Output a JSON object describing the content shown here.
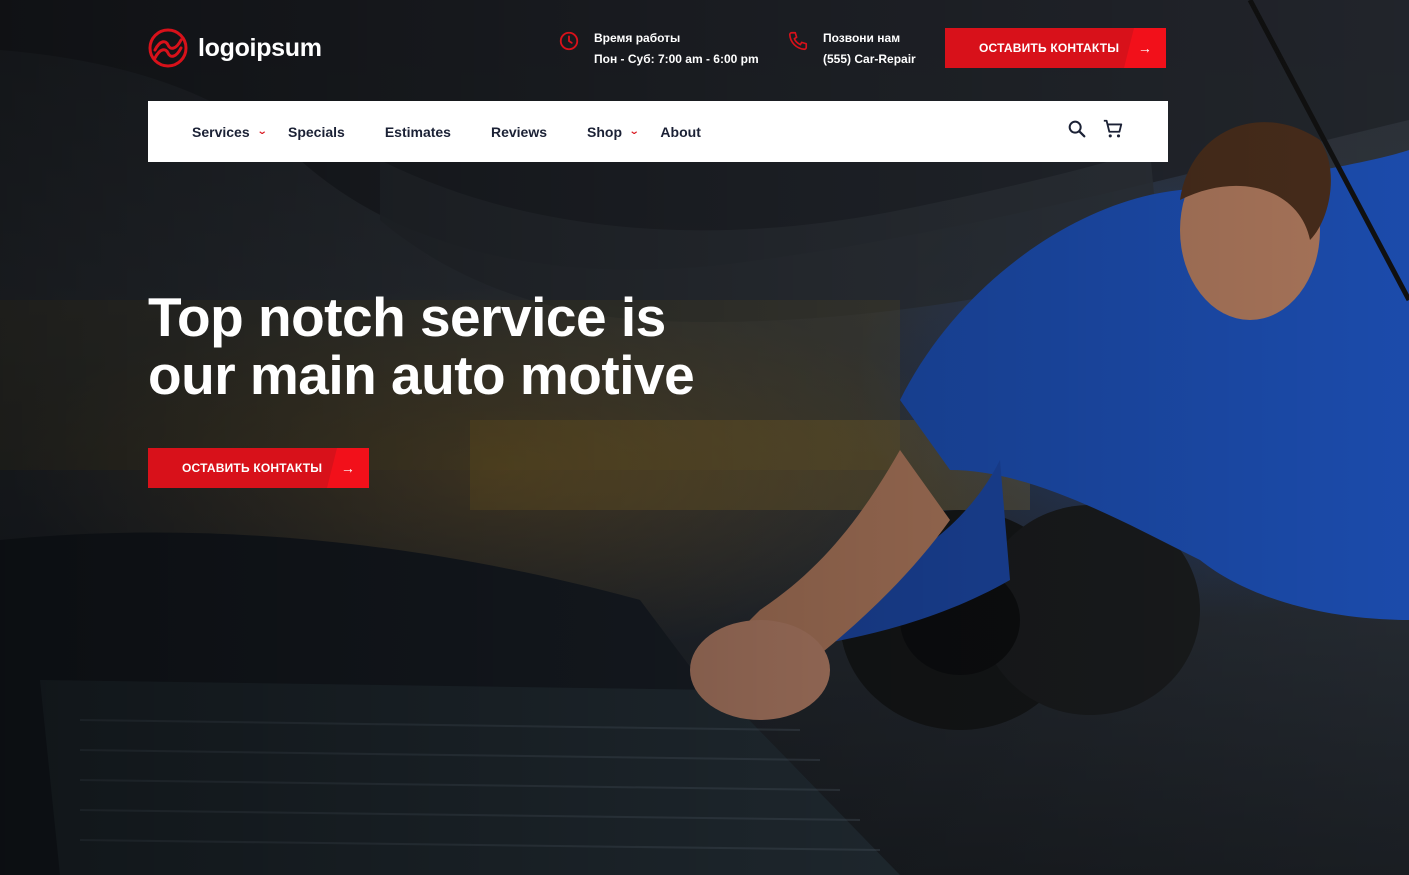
{
  "brand": {
    "name": "logoipsum",
    "accent": "#d8111a",
    "nav_text": "#1b2135"
  },
  "header": {
    "hours": {
      "icon": "clock-icon",
      "label": "Время работы",
      "value": "Пон - Суб: 7:00 am - 6:00 pm"
    },
    "phone": {
      "icon": "phone-icon",
      "label": "Позвони нам",
      "value": "(555) Car-Repair"
    },
    "cta": {
      "label": "ОСТАВИТЬ КОНТАКТЫ",
      "icon": "arrow-right-icon"
    }
  },
  "nav": {
    "items": [
      {
        "label": "Services",
        "dropdown": true
      },
      {
        "label": "Specials",
        "dropdown": false
      },
      {
        "label": "Estimates",
        "dropdown": false
      },
      {
        "label": "Reviews",
        "dropdown": false
      },
      {
        "label": "Shop",
        "dropdown": true
      },
      {
        "label": "About",
        "dropdown": false
      }
    ],
    "tools": [
      "search-icon",
      "cart-icon"
    ]
  },
  "hero": {
    "title_line1": "Top notch service is",
    "title_line2": "our main auto motive",
    "cta": {
      "label": "ОСТАВИТЬ КОНТАКТЫ",
      "icon": "arrow-right-icon"
    }
  }
}
